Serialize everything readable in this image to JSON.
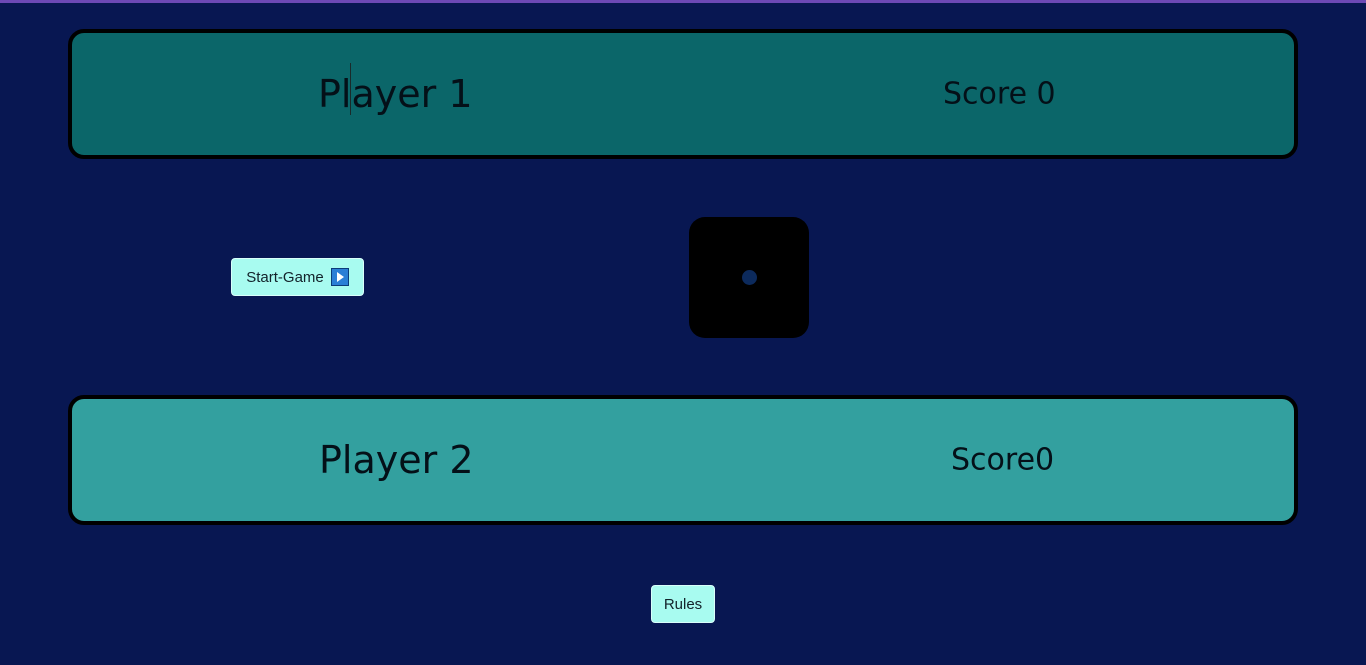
{
  "players": [
    {
      "name": "Player 1",
      "score_text": "Score 0"
    },
    {
      "name": "Player 2",
      "score_text": "Score0"
    }
  ],
  "controls": {
    "start_label": "Start-Game",
    "start_icon": "play-icon",
    "rules_label": "Rules"
  },
  "dice": {
    "value": 1
  },
  "colors": {
    "background": "#081752",
    "player1_panel": "#0b6669",
    "player2_panel": "#33a09f",
    "button": "#a8fbf0",
    "dice": "#000000"
  }
}
